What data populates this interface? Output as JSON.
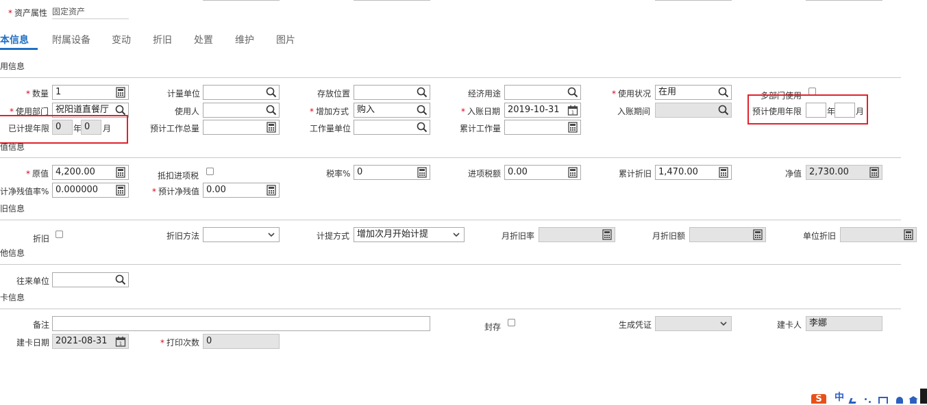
{
  "top": {
    "asset_attr_label": "资产属性",
    "asset_attr_value": "固定资产"
  },
  "tabs": [
    "本信息",
    "附属设备",
    "变动",
    "折旧",
    "处置",
    "维护",
    "图片"
  ],
  "sections": {
    "usage": "用信息",
    "value": "值信息",
    "depreciation": "旧信息",
    "other": "他信息",
    "card": "卡信息"
  },
  "usage": {
    "quantity_label": "数量",
    "quantity_value": "1",
    "unit_label": "计量单位",
    "location_label": "存放位置",
    "econ_use_label": "经济用途",
    "use_status_label": "使用状况",
    "use_status_value": "在用",
    "multi_dept_label": "多部门使用",
    "dept_label": "使用部门",
    "dept_value": "祝阳道直餐厅",
    "user_label": "使用人",
    "add_method_label": "增加方式",
    "add_method_value": "购入",
    "entry_date_label": "入账日期",
    "entry_date_value": "2019-10-31",
    "entry_period_label": "入账期间",
    "expected_years_label": "预计使用年限",
    "year_unit": "年",
    "month_unit": "月",
    "accrued_years_label": "已计提年限",
    "accrued_years_value": "0",
    "accrued_months_value": "0",
    "workload_total_label": "预计工作总量",
    "workload_unit_label": "工作量单位",
    "accum_workload_label": "累计工作量"
  },
  "value": {
    "orig_label": "原值",
    "orig_value": "4,200.00",
    "deduct_tax_label": "抵扣进项税",
    "tax_rate_label": "税率%",
    "tax_rate_value": "0",
    "input_tax_label": "进项税额",
    "input_tax_value": "0.00",
    "accum_dep_label": "累计折旧",
    "accum_dep_value": "1,470.00",
    "net_label": "净值",
    "net_value": "2,730.00",
    "residual_rate_label": "计净残值率%",
    "residual_rate_value": "0.000000",
    "residual_value_label": "预计净残值",
    "residual_value_value": "0.00"
  },
  "depreciation": {
    "dep_label": "折旧",
    "method_label": "折旧方法",
    "accrual_label": "计提方式",
    "accrual_value": "增加次月开始计提",
    "monthly_rate_label": "月折旧率",
    "monthly_amt_label": "月折旧额",
    "unit_dep_label": "单位折旧"
  },
  "other": {
    "partner_label": "往来单位"
  },
  "card": {
    "remark_label": "备注",
    "sealed_label": "封存",
    "voucher_label": "生成凭证",
    "creator_label": "建卡人",
    "creator_value": "李娜",
    "card_date_label": "建卡日期",
    "card_date_value": "2021-08-31",
    "print_count_label": "打印次数",
    "print_count_value": "0"
  },
  "tray": {
    "ime_label": "中"
  },
  "colors": {
    "accent": "#1f6fc5",
    "required": "#d9001b",
    "highlight": "#e0202a",
    "disabled": "#e4e4e4"
  }
}
